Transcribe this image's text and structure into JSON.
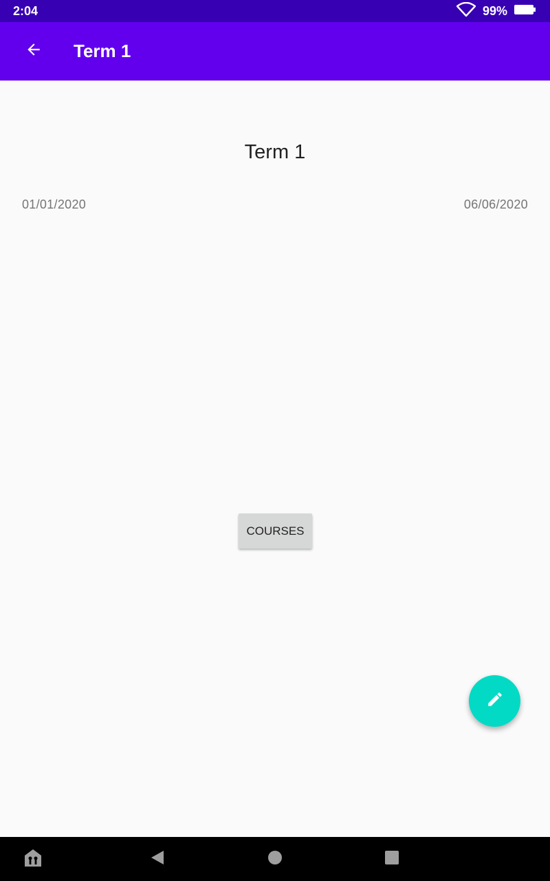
{
  "status_bar": {
    "time": "2:04",
    "battery": "99%",
    "icons": [
      "wifi-icon",
      "battery-icon"
    ]
  },
  "app_bar": {
    "title": "Term 1",
    "back_icon": "arrow-back-icon",
    "color": "#6200ee"
  },
  "term": {
    "title": "Term 1",
    "start_date": "01/01/2020",
    "end_date": "06/06/2020"
  },
  "actions": {
    "courses_label": "COURSES",
    "fab_icon": "edit-pencil-icon",
    "fab_color": "#03dac5"
  },
  "nav_bar": {
    "icons": [
      "accessibility-icon",
      "back-triangle-icon",
      "home-circle-icon",
      "recents-square-icon"
    ]
  }
}
